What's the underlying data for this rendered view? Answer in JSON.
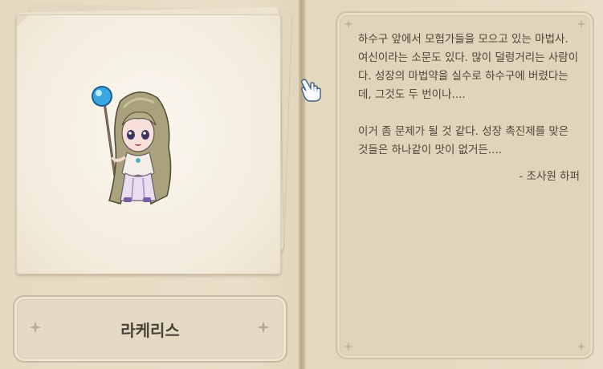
{
  "npc": {
    "name": "라케리스",
    "portrait_icon": "sorceress-npc-portrait"
  },
  "description": {
    "paragraph1": "하수구 앞에서 모험가들을 모으고 있는 마법사. 여신이라는 소문도 있다. 많이 덜렁거리는 사람이다. 성장의 마법약을 실수로 하수구에 버렸다는데, 그것도 두 번이나....",
    "paragraph2": "이거 좀 문제가 될 것 같다. 성장 촉진제를 맞은 것들은 하나같이 맛이 없거든....",
    "signature": "- 조사원 하퍼"
  },
  "colors": {
    "page": "#e7dcc5",
    "text": "#4e4638",
    "frame": "#cfc2a5"
  },
  "icons": [
    "sparkle-icon",
    "hand-cursor-icon",
    "orb-staff-icon"
  ]
}
